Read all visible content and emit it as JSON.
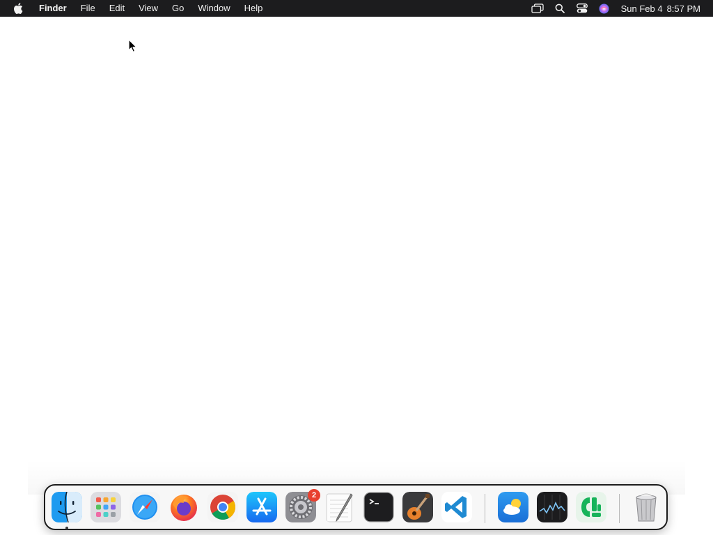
{
  "menubar": {
    "app_name": "Finder",
    "menus": [
      "File",
      "Edit",
      "View",
      "Go",
      "Window",
      "Help"
    ],
    "status_icons": [
      "screen-mirroring-icon",
      "spotlight-search-icon",
      "control-center-icon",
      "siri-icon"
    ],
    "clock": {
      "date": "Sun Feb 4",
      "time": "8:57 PM"
    }
  },
  "dock": {
    "apps": [
      {
        "name": "Finder",
        "icon": "finder-icon",
        "running": true
      },
      {
        "name": "Launchpad",
        "icon": "launchpad-icon"
      },
      {
        "name": "Safari",
        "icon": "safari-icon"
      },
      {
        "name": "Firefox",
        "icon": "firefox-icon"
      },
      {
        "name": "Google Chrome",
        "icon": "chrome-icon"
      },
      {
        "name": "App Store",
        "icon": "app-store-icon"
      },
      {
        "name": "System Settings",
        "icon": "system-settings-icon",
        "badge": "2"
      },
      {
        "name": "TextEdit",
        "icon": "textedit-icon"
      },
      {
        "name": "Terminal",
        "icon": "terminal-icon"
      },
      {
        "name": "GarageBand",
        "icon": "garageband-icon"
      },
      {
        "name": "Visual Studio Code",
        "icon": "vscode-icon"
      }
    ],
    "recents": [
      {
        "name": "Weather",
        "icon": "weather-icon"
      },
      {
        "name": "Stocks",
        "icon": "stocks-icon"
      },
      {
        "name": "Numbers",
        "icon": "numbers-icon"
      }
    ],
    "trash": {
      "name": "Trash",
      "icon": "trash-icon"
    }
  },
  "colors": {
    "menubar_bg": "#1c1c1e",
    "desktop_bg": "#ffffff",
    "badge": "#e8402f"
  }
}
